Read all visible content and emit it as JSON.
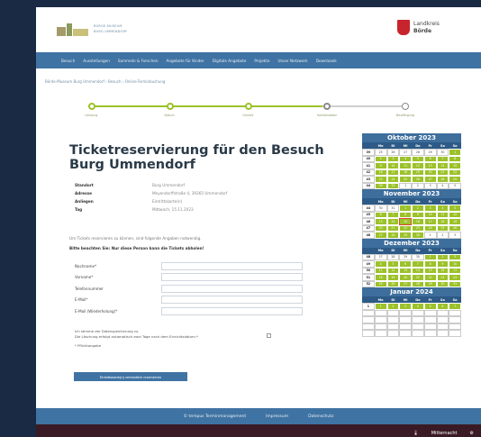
{
  "header": {
    "logo_line1": "BÜRGE-MUSEUM",
    "logo_line2": "BURG UMMENDORF",
    "crest_name1": "Landkreis",
    "crest_name2": "Börde"
  },
  "nav": [
    "Besuch",
    "Ausstellungen",
    "Sammeln & Forschen",
    "Angebote für Kinder",
    "Digitale Angebote",
    "Projekte",
    "Unser Netzwerk",
    "Downloads"
  ],
  "breadcrumb": "Börde-Museum Burg Ummendorf  ›  Besuch  ›  Online-Terminbuchung",
  "steps": {
    "labels": [
      "Leistung",
      "Datum",
      "Uhrzeit",
      "Kontaktdaten",
      "Bestätigung"
    ]
  },
  "page_title": "Ticketreservierung für den Besuch Burg Ummendorf",
  "info": [
    {
      "k": "Standort",
      "v": "Burg Ummendorf"
    },
    {
      "k": "Adresse",
      "v": "Meyendorffstraße 4, 39365 Ummendorf"
    },
    {
      "k": "Anliegen",
      "v": "Eintrittskarte(n)"
    },
    {
      "k": "Tag",
      "v": "Mittwoch, 15.11.2023"
    }
  ],
  "hint": "Um Tickets reservieren zu können, sind folgende Angaben notwendig.",
  "hint_bold": "Bitte beachten Sie: Nur diese Person kann die Tickets abholen!",
  "form": {
    "fields": [
      "Nachname*",
      "Vorname*",
      "Telefonnummer",
      "E-Mail*",
      "E-Mail (Wiederholung)*"
    ],
    "privacy_1": "Ich stimme der Datenspeicherung zu.",
    "privacy_2": "Die Löschung erfolgt automatisch zwei Tage nach dem Einrichtsdatum.*",
    "required_note": "* Pflichtangabe",
    "submit": "Eintrittskarte(n) verbindlich reservieren"
  },
  "calendar": {
    "weekday_headers": [
      "Mo",
      "Di",
      "Mi",
      "Do",
      "Fr",
      "Sa",
      "So"
    ],
    "months": [
      {
        "name": "Oktober 2023",
        "rows": [
          [
            "39",
            "25",
            "26",
            "27",
            "28",
            "29",
            "30",
            "1"
          ],
          [
            "40",
            "2",
            "3",
            "4",
            "5",
            "6",
            "7",
            "8"
          ],
          [
            "41",
            "9",
            "10",
            "11",
            "12",
            "13",
            "14",
            "15"
          ],
          [
            "42",
            "16",
            "17",
            "18",
            "19",
            "20",
            "21",
            "22"
          ],
          [
            "43",
            "23",
            "24",
            "25",
            "26",
            "27",
            "28",
            "29"
          ],
          [
            "44",
            "30",
            "31",
            "1",
            "2",
            "3",
            "4",
            "5"
          ]
        ]
      },
      {
        "name": "November 2023",
        "rows": [
          [
            "44",
            "30",
            "31",
            "1",
            "2",
            "3",
            "4",
            "5"
          ],
          [
            "45",
            "6",
            "7",
            "8",
            "9",
            "10",
            "11",
            "12"
          ],
          [
            "46",
            "13",
            "14",
            "15",
            "16",
            "17",
            "18",
            "19"
          ],
          [
            "47",
            "20",
            "21",
            "22",
            "23",
            "24",
            "25",
            "26"
          ],
          [
            "48",
            "27",
            "28",
            "29",
            "30",
            "1",
            "2",
            "3"
          ]
        ]
      },
      {
        "name": "Dezember 2023",
        "rows": [
          [
            "48",
            "27",
            "28",
            "29",
            "30",
            "1",
            "2",
            "3"
          ],
          [
            "49",
            "4",
            "5",
            "6",
            "7",
            "8",
            "9",
            "10"
          ],
          [
            "50",
            "11",
            "12",
            "13",
            "14",
            "15",
            "16",
            "17"
          ],
          [
            "51",
            "18",
            "19",
            "20",
            "21",
            "22",
            "23",
            "24"
          ],
          [
            "52",
            "25",
            "26",
            "27",
            "28",
            "29",
            "30",
            "31"
          ]
        ]
      },
      {
        "name": "Januar 2024",
        "rows": [
          [
            "1",
            "1",
            "2",
            "3",
            "4",
            "5",
            "6",
            "7"
          ],
          [
            "",
            "",
            "",
            "",
            "",
            "",
            "",
            ""
          ],
          [
            "",
            "",
            "",
            "",
            "",
            "",
            "",
            ""
          ],
          [
            "",
            "",
            "",
            "",
            "",
            "",
            "",
            ""
          ],
          [
            "",
            "",
            "",
            "",
            "",
            "",
            "",
            ""
          ]
        ]
      }
    ]
  },
  "footer": [
    "© tempus Terminmanagement",
    "Impressum",
    "Datenschutz"
  ],
  "taskbar": {
    "weather": "Mitternacht"
  }
}
